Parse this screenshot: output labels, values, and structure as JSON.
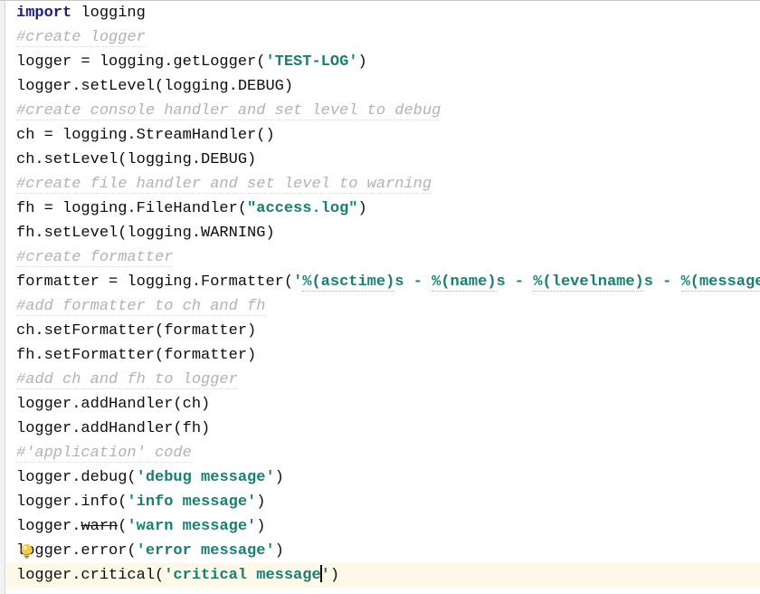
{
  "editor": {
    "language": "python",
    "background_color": "#ffffff",
    "current_line_highlight_color": "#fdf8e7",
    "gutter_color": "#f2f2f2",
    "colors": {
      "keyword": "#20207a",
      "comment": "#b2b2b2",
      "string": "#1a7f72",
      "plain": "#0d0d0d",
      "caret": "#000000",
      "bulb": "#f5c518"
    },
    "caret": {
      "line_index": 24,
      "after_text": "logger.critical('critical message"
    },
    "intention_bulb": {
      "icon": "lightbulb-icon",
      "line_index": 23
    },
    "lines": [
      {
        "index": 0,
        "current": false,
        "tokens": [
          {
            "type": "keyword",
            "text": "import"
          },
          {
            "type": "plain",
            "text": " logging"
          }
        ]
      },
      {
        "index": 1,
        "current": false,
        "tokens": [
          {
            "type": "comment",
            "text": "#create logger"
          }
        ]
      },
      {
        "index": 2,
        "current": false,
        "tokens": [
          {
            "type": "plain",
            "text": "logger = logging.getLogger("
          },
          {
            "type": "string",
            "text": "'TEST-LOG'"
          },
          {
            "type": "plain",
            "text": ")"
          }
        ]
      },
      {
        "index": 3,
        "current": false,
        "tokens": [
          {
            "type": "plain",
            "text": "logger.setLevel(logging.DEBUG)"
          }
        ]
      },
      {
        "index": 4,
        "current": false,
        "tokens": [
          {
            "type": "comment",
            "text": "#create console handler and set level to debug"
          }
        ]
      },
      {
        "index": 5,
        "current": false,
        "tokens": [
          {
            "type": "plain",
            "text": "ch = logging.StreamHandler()"
          }
        ]
      },
      {
        "index": 6,
        "current": false,
        "tokens": [
          {
            "type": "plain",
            "text": "ch.setLevel(logging.DEBUG)"
          }
        ]
      },
      {
        "index": 7,
        "current": false,
        "tokens": [
          {
            "type": "comment",
            "text": "#create file handler and set level to warning"
          }
        ]
      },
      {
        "index": 8,
        "current": false,
        "tokens": [
          {
            "type": "plain",
            "text": "fh = logging.FileHandler("
          },
          {
            "type": "string",
            "text": "\"access.log\""
          },
          {
            "type": "plain",
            "text": ")"
          }
        ]
      },
      {
        "index": 9,
        "current": false,
        "tokens": [
          {
            "type": "plain",
            "text": "fh.setLevel(logging.WARNING)"
          }
        ]
      },
      {
        "index": 10,
        "current": false,
        "tokens": [
          {
            "type": "comment",
            "text": "#create formatter"
          }
        ]
      },
      {
        "index": 11,
        "current": false,
        "tokens": [
          {
            "type": "plain",
            "text": "formatter = logging.Formatter("
          },
          {
            "type": "string",
            "text": "'"
          },
          {
            "type": "fmt",
            "text": "%(asctime)"
          },
          {
            "type": "string",
            "text": "s - "
          },
          {
            "type": "fmt",
            "text": "%(name)"
          },
          {
            "type": "string",
            "text": "s - "
          },
          {
            "type": "fmt",
            "text": "%(levelname)"
          },
          {
            "type": "string",
            "text": "s - "
          },
          {
            "type": "fmt",
            "text": "%(message)"
          },
          {
            "type": "string",
            "text": "s'"
          },
          {
            "type": "plain",
            "text": ")"
          }
        ]
      },
      {
        "index": 12,
        "current": false,
        "tokens": [
          {
            "type": "comment",
            "text": "#add formatter to ch and fh"
          }
        ]
      },
      {
        "index": 13,
        "current": false,
        "tokens": [
          {
            "type": "plain",
            "text": "ch.setFormatter(formatter)"
          }
        ]
      },
      {
        "index": 14,
        "current": false,
        "tokens": [
          {
            "type": "plain",
            "text": "fh.setFormatter(formatter)"
          }
        ]
      },
      {
        "index": 15,
        "current": false,
        "tokens": [
          {
            "type": "comment",
            "text": "#add ch and fh to logger"
          }
        ]
      },
      {
        "index": 16,
        "current": false,
        "tokens": [
          {
            "type": "plain",
            "text": "logger.addHandler(ch)"
          }
        ]
      },
      {
        "index": 17,
        "current": false,
        "tokens": [
          {
            "type": "plain",
            "text": "logger.addHandler(fh)"
          }
        ]
      },
      {
        "index": 18,
        "current": false,
        "tokens": [
          {
            "type": "comment",
            "text": "#'application' code"
          }
        ]
      },
      {
        "index": 19,
        "current": false,
        "tokens": [
          {
            "type": "plain",
            "text": "logger.debug("
          },
          {
            "type": "string",
            "text": "'debug message'"
          },
          {
            "type": "plain",
            "text": ")"
          }
        ]
      },
      {
        "index": 20,
        "current": false,
        "tokens": [
          {
            "type": "plain",
            "text": "logger.info("
          },
          {
            "type": "string",
            "text": "'info message'"
          },
          {
            "type": "plain",
            "text": ")"
          }
        ]
      },
      {
        "index": 21,
        "current": false,
        "tokens": [
          {
            "type": "plain",
            "text": "logger."
          },
          {
            "type": "deprecated",
            "text": "warn"
          },
          {
            "type": "plain",
            "text": "("
          },
          {
            "type": "string",
            "text": "'warn message'"
          },
          {
            "type": "plain",
            "text": ")"
          }
        ]
      },
      {
        "index": 22,
        "current": false,
        "tokens": []
      },
      {
        "index": 23,
        "current": false,
        "bulb": true,
        "tokens": [
          {
            "type": "plain",
            "text": "logger.error("
          },
          {
            "type": "string",
            "text": "'error message'"
          },
          {
            "type": "plain",
            "text": ")"
          }
        ]
      },
      {
        "index": 24,
        "current": true,
        "tokens": [
          {
            "type": "plain",
            "text": "logger.critical("
          },
          {
            "type": "string",
            "text": "'critical message"
          },
          {
            "type": "caret",
            "text": ""
          },
          {
            "type": "string",
            "text": "'"
          },
          {
            "type": "plain",
            "text": ")"
          }
        ]
      }
    ]
  }
}
